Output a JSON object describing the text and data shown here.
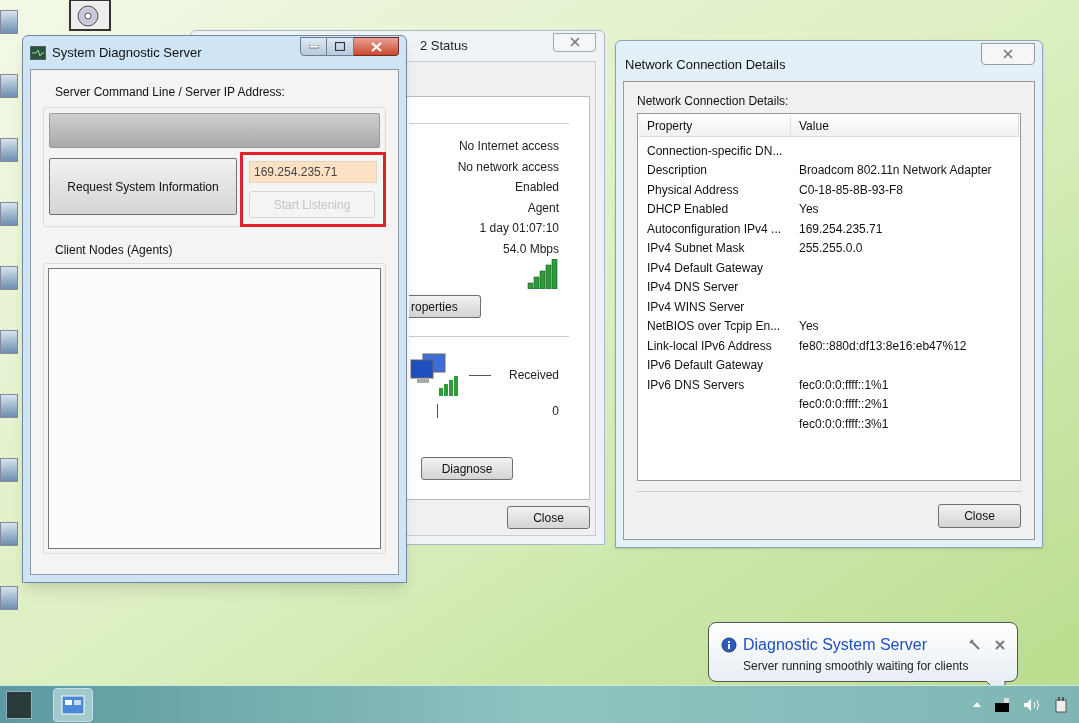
{
  "diagnostic_window": {
    "title": "System Diagnostic Server",
    "server_group": {
      "label": "Server Command Line / Server IP Address:",
      "command_field": {
        "disabled": true
      }
    },
    "request_button": {
      "label": "Request System Information"
    },
    "ip_field": {
      "value": "169.254.235.71"
    },
    "listen_button": {
      "label": "Start Listening",
      "disabled": true
    },
    "highlighted": true,
    "clients_group": {
      "label": "Client Nodes (Agents)"
    }
  },
  "status_window": {
    "title": "2 Status",
    "connection_rows": [
      {
        "kind": "text",
        "value": "No Internet access"
      },
      {
        "kind": "text",
        "value": "No network access"
      },
      {
        "kind": "text",
        "value": "Enabled"
      },
      {
        "kind": "text",
        "value": "Agent"
      },
      {
        "kind": "text",
        "value": "1 day 01:07:10"
      },
      {
        "kind": "text",
        "value": "54.0 Mbps"
      },
      {
        "kind": "signal"
      }
    ],
    "properties_button": "roperties",
    "activity": {
      "received": "Received",
      "packets_received": "0"
    },
    "diagnose_button": "Diagnose",
    "close": "Close"
  },
  "details_window": {
    "title": "Network Connection Details",
    "label": "Network Connection Details:",
    "columns": [
      "Property",
      "Value"
    ],
    "rows": [
      {
        "property": "Connection-specific DN..."
      },
      {
        "property": "Description",
        "values": [
          "Broadcom 802.11n Network Adapter"
        ]
      },
      {
        "property": "Physical Address",
        "values": [
          "C0-18-85-8B-93-F8"
        ]
      },
      {
        "property": "DHCP Enabled",
        "values": [
          "Yes"
        ]
      },
      {
        "property": "Autoconfiguration IPv4 ...",
        "values": [
          "169.254.235.71"
        ]
      },
      {
        "property": "IPv4 Subnet Mask",
        "values": [
          "255.255.0.0"
        ]
      },
      {
        "property": "IPv4 Default Gateway"
      },
      {
        "property": "IPv4 DNS Server"
      },
      {
        "property": "IPv4 WINS Server"
      },
      {
        "property": "NetBIOS over Tcpip En...",
        "values": [
          "Yes"
        ]
      },
      {
        "property": "Link-local IPv6 Address",
        "values": [
          "fe80::880d:df13:8e16:eb47%12"
        ]
      },
      {
        "property": "IPv6 Default Gateway"
      },
      {
        "property": "IPv6 DNS Servers",
        "values": [
          "fec0:0:0:ffff::1%1",
          "fec0:0:0:ffff::2%1",
          "fec0:0:0:ffff::3%1"
        ]
      }
    ],
    "close": "Close"
  },
  "notification": {
    "title": "Diagnostic System Server",
    "message": "Server running smoothly waiting for clients"
  }
}
